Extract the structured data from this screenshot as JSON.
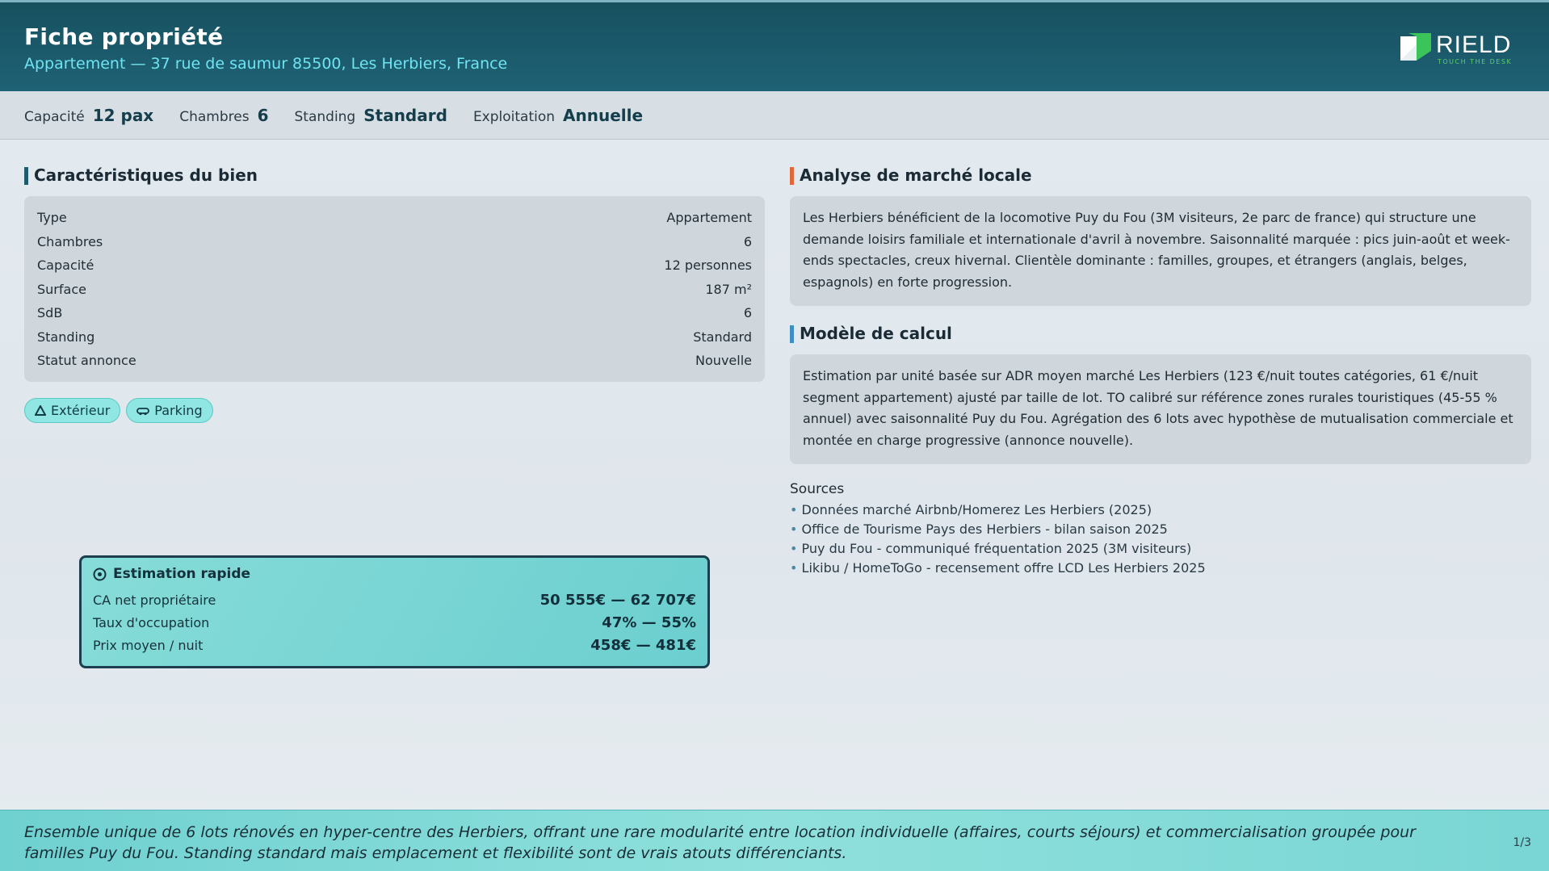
{
  "header": {
    "title": "Fiche propriété",
    "subtitle": "Appartement — 37 rue de saumur 85500, Les Herbiers, France",
    "logo_text": "RIELD",
    "logo_tagline": "TOUCH THE DESK"
  },
  "stats": [
    {
      "label": "Capacité",
      "value": "12 pax"
    },
    {
      "label": "Chambres",
      "value": "6"
    },
    {
      "label": "Standing",
      "value": "Standard"
    },
    {
      "label": "Exploitation",
      "value": "Annuelle"
    }
  ],
  "characteristics": {
    "title": "Caractéristiques du bien",
    "rows": [
      {
        "label": "Type",
        "value": "Appartement"
      },
      {
        "label": "Chambres",
        "value": "6"
      },
      {
        "label": "Capacité",
        "value": "12 personnes"
      },
      {
        "label": "Surface",
        "value": "187 m²"
      },
      {
        "label": "SdB",
        "value": "6"
      },
      {
        "label": "Standing",
        "value": "Standard"
      },
      {
        "label": "Statut annonce",
        "value": "Nouvelle"
      }
    ]
  },
  "tags": [
    {
      "label": "Extérieur",
      "icon": "tree-icon"
    },
    {
      "label": "Parking",
      "icon": "car-icon"
    }
  ],
  "quick_estimate": {
    "title": "Estimation rapide",
    "rows": [
      {
        "label": "CA net propriétaire",
        "value": "50 555€ — 62 707€"
      },
      {
        "label": "Taux d'occupation",
        "value": "47% — 55%"
      },
      {
        "label": "Prix moyen / nuit",
        "value": "458€ — 481€"
      }
    ]
  },
  "market": {
    "title": "Analyse de marché locale",
    "text": "Les Herbiers bénéficient de la locomotive Puy du Fou (3M visiteurs, 2e parc de france) qui structure une demande loisirs familiale et internationale d'avril à novembre. Saisonnalité marquée : pics juin-août et week-ends spectacles, creux hivernal. Clientèle dominante : familles, groupes, et étrangers (anglais, belges, espagnols) en forte progression."
  },
  "model": {
    "title": "Modèle de calcul",
    "text": "Estimation par unité basée sur ADR moyen marché Les Herbiers (123 €/nuit toutes catégories, 61 €/nuit segment appartement) ajusté par taille de lot. TO calibré sur référence zones rurales touristiques (45-55 % annuel) avec saisonnalité Puy du Fou. Agrégation des 6 lots avec hypothèse de mutualisation commerciale et montée en charge progressive (annonce nouvelle)."
  },
  "sources": {
    "title": "Sources",
    "items": [
      "Données marché Airbnb/Homerez Les Herbiers (2025)",
      "Office de Tourisme Pays des Herbiers - bilan saison 2025",
      "Puy du Fou - communiqué fréquentation 2025 (3M visiteurs)",
      "Likibu / HomeToGo - recensement offre LCD Les Herbiers 2025"
    ]
  },
  "footer": {
    "text": "Ensemble unique de 6 lots rénovés en hyper-centre des Herbiers, offrant une rare modularité entre location individuelle (affaires, courts séjours) et commercialisation groupée pour familles Puy du Fou. Standing standard mais emplacement et flexibilité sont de vrais atouts différenciants.",
    "page": "1/3"
  },
  "colors": {
    "header_bg": "#16505f",
    "accent_cyan": "#6fe3f0",
    "pill_bg": "#8fe6e2",
    "market_accent": "#e0673a",
    "model_accent": "#3d8ec2"
  }
}
